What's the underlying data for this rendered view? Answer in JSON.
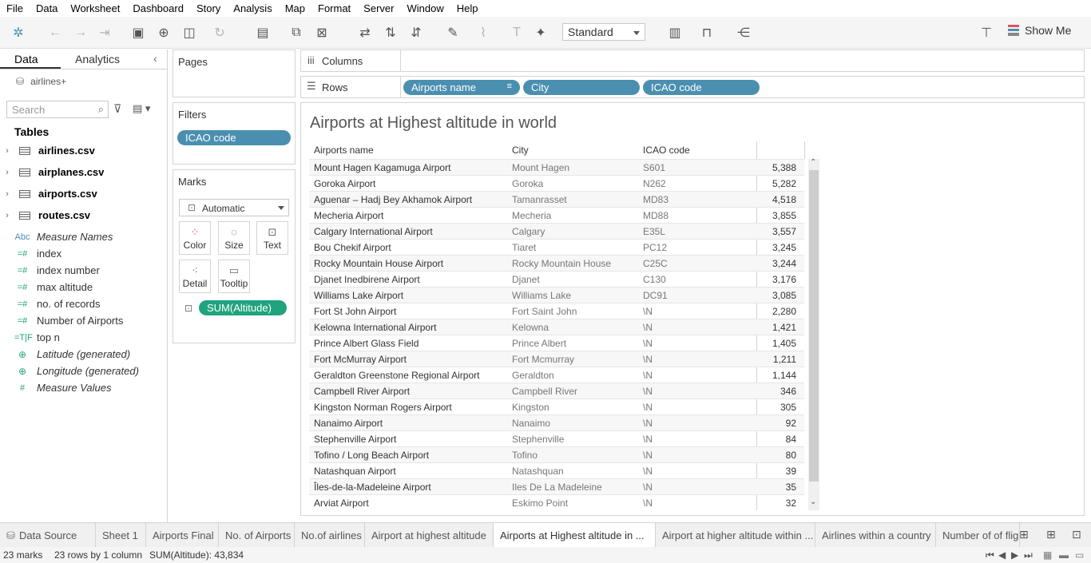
{
  "menu": [
    "File",
    "Data",
    "Worksheet",
    "Dashboard",
    "Story",
    "Analysis",
    "Map",
    "Format",
    "Server",
    "Window",
    "Help"
  ],
  "toolbar": {
    "fit": "Standard",
    "show_me": "Show Me"
  },
  "left": {
    "tab_data": "Data",
    "tab_analytics": "Analytics",
    "datasource": "airlines+",
    "search_placeholder": "Search",
    "tables_heading": "Tables",
    "tables": [
      "airlines.csv",
      "airplanes.csv",
      "airports.csv",
      "routes.csv"
    ],
    "fields": [
      {
        "icon": "Abc",
        "name": "Measure Names",
        "italic": true
      },
      {
        "icon": "=#",
        "name": "index",
        "italic": false
      },
      {
        "icon": "=#",
        "name": "index number",
        "italic": false
      },
      {
        "icon": "=#",
        "name": "max altitude",
        "italic": false
      },
      {
        "icon": "=#",
        "name": "no. of records",
        "italic": false
      },
      {
        "icon": "=#",
        "name": "Number of Airports",
        "italic": false
      },
      {
        "icon": "=T|F",
        "name": "top n",
        "italic": false
      },
      {
        "icon": "globe",
        "name": "Latitude (generated)",
        "italic": true
      },
      {
        "icon": "globe",
        "name": "Longitude (generated)",
        "italic": true
      },
      {
        "icon": "#",
        "name": "Measure Values",
        "italic": true
      }
    ]
  },
  "pages": {
    "title": "Pages"
  },
  "filters": {
    "title": "Filters",
    "pill": "ICAO code"
  },
  "marks": {
    "title": "Marks",
    "type": "Automatic",
    "color": "Color",
    "size": "Size",
    "text": "Text",
    "detail": "Detail",
    "tooltip": "Tooltip",
    "pill": "SUM(Altitude)"
  },
  "shelves": {
    "columns": "Columns",
    "rows": "Rows",
    "row_pills": [
      "Airports name",
      "City",
      "ICAO code"
    ]
  },
  "view": {
    "title": "Airports at Highest altitude in world",
    "headers": [
      "Airports name",
      "City",
      "ICAO code"
    ],
    "rows": [
      [
        "Mount Hagen Kagamuga Airport",
        "Mount Hagen",
        "S601",
        "5,388"
      ],
      [
        "Goroka Airport",
        "Goroka",
        "N262",
        "5,282"
      ],
      [
        "Aguenar – Hadj Bey Akhamok Airport",
        "Tamanrasset",
        "MD83",
        "4,518"
      ],
      [
        "Mecheria Airport",
        "Mecheria",
        "MD88",
        "3,855"
      ],
      [
        "Calgary International Airport",
        "Calgary",
        "E35L",
        "3,557"
      ],
      [
        "Bou Chekif Airport",
        "Tiaret",
        "PC12",
        "3,245"
      ],
      [
        "Rocky Mountain House Airport",
        "Rocky Mountain House",
        "C25C",
        "3,244"
      ],
      [
        "Djanet Inedbirene Airport",
        "Djanet",
        "C130",
        "3,176"
      ],
      [
        "Williams Lake Airport",
        "Williams Lake",
        "DC91",
        "3,085"
      ],
      [
        "Fort St John Airport",
        "Fort Saint John",
        "\\N",
        "2,280"
      ],
      [
        "Kelowna International Airport",
        "Kelowna",
        "\\N",
        "1,421"
      ],
      [
        "Prince Albert Glass Field",
        "Prince Albert",
        "\\N",
        "1,405"
      ],
      [
        "Fort McMurray Airport",
        "Fort Mcmurray",
        "\\N",
        "1,211"
      ],
      [
        "Geraldton Greenstone Regional Airport",
        "Geraldton",
        "\\N",
        "1,144"
      ],
      [
        "Campbell River Airport",
        "Campbell River",
        "\\N",
        "346"
      ],
      [
        "Kingston Norman Rogers Airport",
        "Kingston",
        "\\N",
        "305"
      ],
      [
        "Nanaimo Airport",
        "Nanaimo",
        "\\N",
        "92"
      ],
      [
        "Stephenville Airport",
        "Stephenville",
        "\\N",
        "84"
      ],
      [
        "Tofino / Long Beach Airport",
        "Tofino",
        "\\N",
        "80"
      ],
      [
        "Natashquan Airport",
        "Natashquan",
        "\\N",
        "39"
      ],
      [
        "Îles-de-la-Madeleine Airport",
        "Iles De La Madeleine",
        "\\N",
        "35"
      ],
      [
        "Arviat Airport",
        "Eskimo Point",
        "\\N",
        "32"
      ]
    ]
  },
  "sheet_tabs": [
    "Data Source",
    "Sheet 1",
    "Airports Final",
    "No. of Airports",
    "No.of airlines",
    "Airport at highest altitude",
    "Airports at Highest altitude in ...",
    "Airport at higher altitude within ...",
    "Airlines within a country",
    "Number of of flig"
  ],
  "active_tab_index": 6,
  "status": {
    "marks": "23 marks",
    "dims": "23 rows by 1 column",
    "sum": "SUM(Altitude): 43,834"
  }
}
